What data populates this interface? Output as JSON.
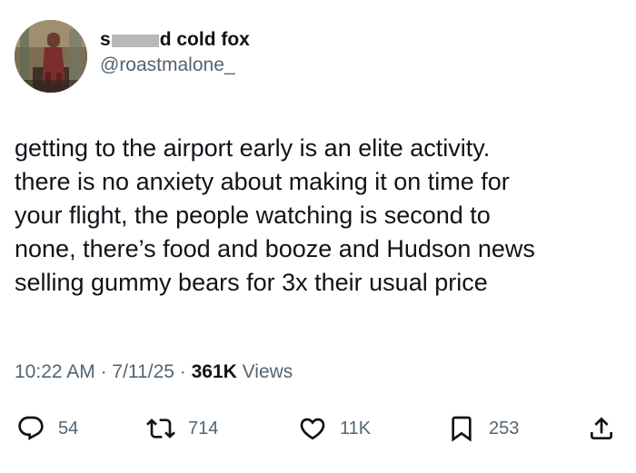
{
  "author": {
    "display_name_start": "s",
    "display_name_end": "d cold fox",
    "handle": "@roastmalone_"
  },
  "tweet": {
    "lines": [
      "getting to the airport early is an elite activity.",
      "there is no anxiety about making it on time for",
      "your flight, the people watching is second to",
      "none, there’s food and booze and Hudson news",
      "selling gummy bears for 3x their usual price"
    ],
    "time": "10:22 AM",
    "date": "7/11/25",
    "separator": "·",
    "views_count": "361K",
    "views_label": "Views"
  },
  "actions": {
    "replies": "54",
    "reposts": "714",
    "likes": "11K",
    "bookmarks": "253"
  },
  "icons": {
    "reply": "reply-icon",
    "repost": "repost-icon",
    "like": "heart-icon",
    "bookmark": "bookmark-icon",
    "share": "share-icon"
  },
  "colors": {
    "text": "#0f1419",
    "secondary": "#536471",
    "redaction": "#b8b8b8"
  }
}
